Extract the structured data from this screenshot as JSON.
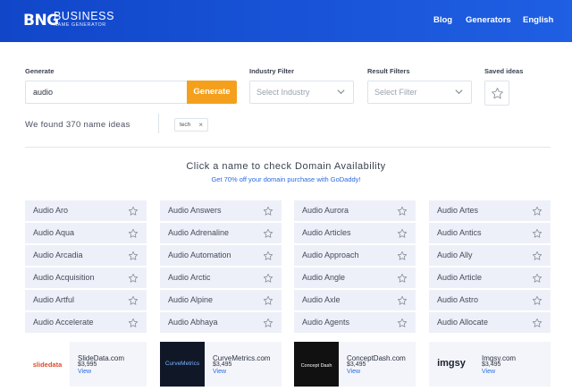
{
  "header": {
    "logo_mark": "BNG",
    "logo_title": "BUSINESS",
    "logo_sub": "NAME GENERATOR",
    "nav": [
      "Blog",
      "Generators",
      "English"
    ]
  },
  "form": {
    "generate_label": "Generate",
    "input_value": "audio",
    "generate_button": "Generate",
    "industry_label": "Industry Filter",
    "industry_placeholder": "Select Industry",
    "result_label": "Result Filters",
    "result_placeholder": "Select Filter",
    "saved_label": "Saved ideas"
  },
  "results": {
    "found_text": "We found 370 name ideas",
    "tag": "tech",
    "tag_remove": "×",
    "hint": "Click a name to check Domain Availability",
    "promo": "Get 70% off your domain purchase with GoDaddy!"
  },
  "names": [
    [
      "Audio Aro",
      "Audio Answers",
      "Audio Aurora",
      "Audio Artes"
    ],
    [
      "Audio Aqua",
      "Audio Adrenaline",
      "Audio Articles",
      "Audio Antics"
    ],
    [
      "Audio Arcadia",
      "Audio Automation",
      "Audio Approach",
      "Audio Ally"
    ],
    [
      "Audio Acquisition",
      "Audio Arctic",
      "Audio Angle",
      "Audio Article"
    ],
    [
      "Audio Artful",
      "Audio Alpine",
      "Audio Axle",
      "Audio Astro"
    ],
    [
      "Audio Accelerate",
      "Audio Abhaya",
      "Audio Agents",
      "Audio Allocate"
    ]
  ],
  "ads": [
    {
      "thumb": "slidedata",
      "name": "SlideData.com",
      "price": "$3,995",
      "view": "View"
    },
    {
      "thumb": "CurveMetrics",
      "name": "CurveMetrics.com",
      "price": "$3,495",
      "view": "View"
    },
    {
      "thumb": "Concept Dash",
      "name": "ConceptDash.com",
      "price": "$3,495",
      "view": "View"
    },
    {
      "thumb": "imgsy",
      "name": "Imgsy.com",
      "price": "$3,495",
      "view": "View"
    }
  ],
  "colors": {
    "header_blue": "#1f5fe3",
    "generate_orange": "#f5a01c",
    "card_bg": "#eef0f9",
    "link_blue": "#2b6be0"
  }
}
